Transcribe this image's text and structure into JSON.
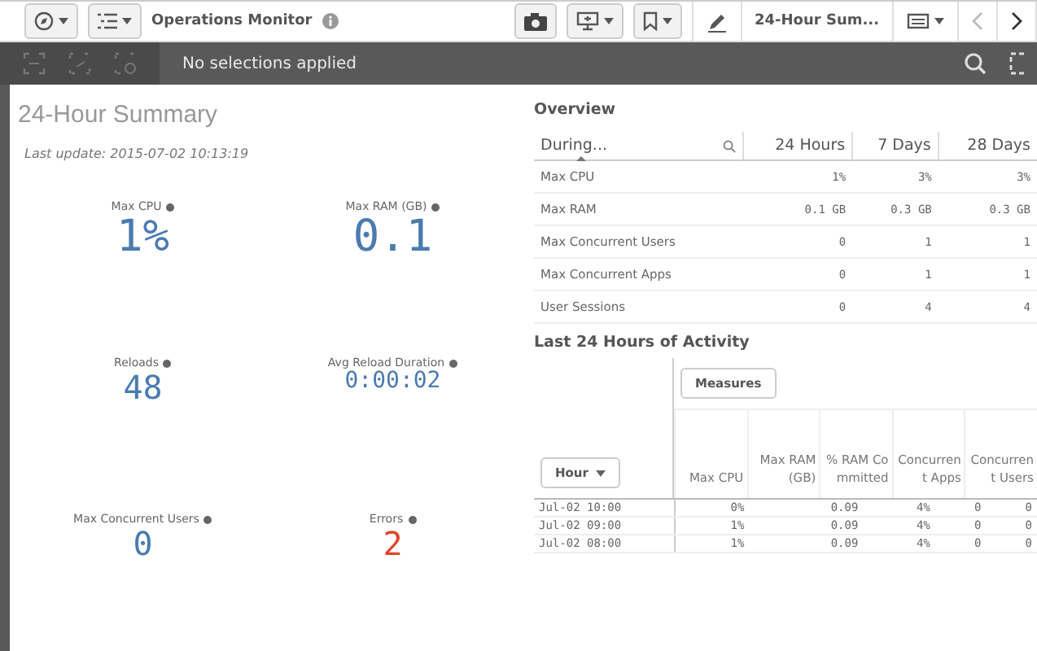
{
  "toolbar": {
    "title": "Operations Monitor",
    "sheet": "24-Hour Sum..."
  },
  "selection_bar": {
    "text": "No selections applied"
  },
  "summary": {
    "title": "24-Hour Summary",
    "last_update": "Last update: 2015-07-02 10:13:19",
    "kpis": [
      {
        "label": "Max CPU",
        "value": "1%",
        "color": "#4a7bb0"
      },
      {
        "label": "Max RAM (GB)",
        "value": "0.1",
        "color": "#4a7bb0"
      },
      {
        "label": "Reloads",
        "value": "48",
        "color": "#4a7bb0"
      },
      {
        "label": "Avg Reload Duration",
        "value": "0:00:02",
        "color": "#4a7bb0"
      },
      {
        "label": "Max Concurrent Users",
        "value": "0",
        "color": "#4a7bb0"
      },
      {
        "label": "Errors",
        "value": "2",
        "color": "#e0452b"
      }
    ]
  },
  "overview": {
    "title": "Overview",
    "columns": [
      "During...",
      "24 Hours",
      "7 Days",
      "28 Days"
    ],
    "rows": [
      [
        "Max CPU",
        "1%",
        "3%",
        "3%"
      ],
      [
        "Max RAM",
        "0.1 GB",
        "0.3 GB",
        "0.3 GB"
      ],
      [
        "Max Concurrent Users",
        "0",
        "1",
        "1"
      ],
      [
        "Max Concurrent Apps",
        "0",
        "1",
        "1"
      ],
      [
        "User Sessions",
        "0",
        "4",
        "4"
      ]
    ]
  },
  "activity": {
    "title": "Last 24 Hours of Activity",
    "measures_button": "Measures",
    "columns": [
      "Hour",
      "Max CPU",
      "Max RAM (GB)",
      "% RAM Committed",
      "Concurrent Apps",
      "Concurrent Users"
    ],
    "rows": [
      [
        "Jul-02 10:00",
        "0%",
        "0.09",
        "4%",
        "0",
        "0"
      ],
      [
        "Jul-02 09:00",
        "1%",
        "0.09",
        "4%",
        "0",
        "0"
      ],
      [
        "Jul-02 08:00",
        "1%",
        "0.09",
        "4%",
        "0",
        "0"
      ]
    ]
  }
}
